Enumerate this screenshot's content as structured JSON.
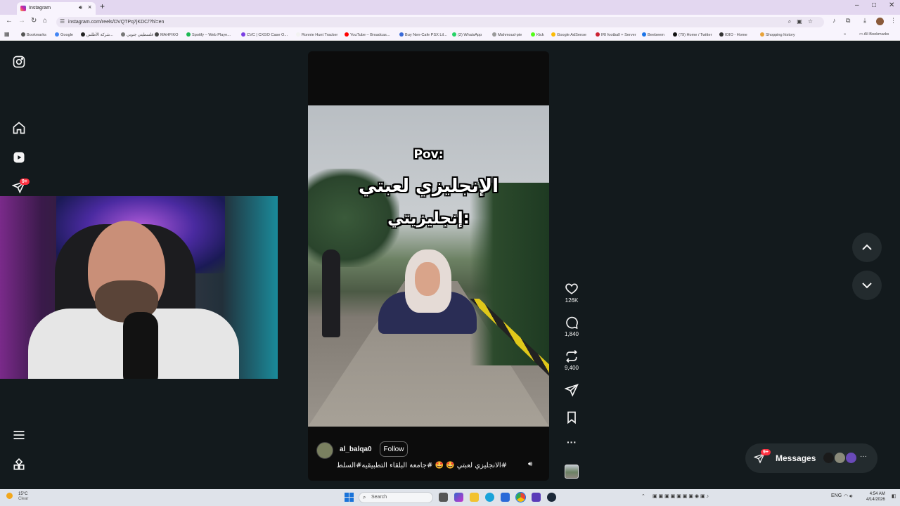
{
  "browser": {
    "tab_title": "Instagram",
    "url": "instagram.com/reels/DVQTPq7jKDC/?hl=en",
    "tab_sound_icon": "speaker-icon",
    "new_tab_label": "+",
    "bookmarks": [
      {
        "label": "Bookmarks",
        "color": "#555555"
      },
      {
        "label": "Google",
        "color": "#4285f4"
      },
      {
        "label": "شركة الأطلس...",
        "color": "#222222"
      },
      {
        "label": "فلسطيني جنوبي",
        "color": "#777777"
      },
      {
        "label": "MAHFIKO",
        "color": "#444444"
      },
      {
        "label": "Spotify – Web Playe...",
        "color": "#1db954"
      },
      {
        "label": "CVC | CXGO Case O...",
        "color": "#7b3fe4"
      },
      {
        "label": "Ronnie Hunt Tracker",
        "color": "#f2f2f2"
      },
      {
        "label": "YouTube – Broadcas...",
        "color": "#ff0000"
      },
      {
        "label": "Buy Nen-Cafe PSX Lil...",
        "color": "#3a6ad8"
      },
      {
        "label": "(2) WhatsApp",
        "color": "#25d366"
      },
      {
        "label": "Mahmoud-pie",
        "color": "#999999"
      },
      {
        "label": "Kick",
        "color": "#53fc18"
      },
      {
        "label": "Google AdSense",
        "color": "#fbbc05"
      },
      {
        "label": "IRI football + Server",
        "color": "#cc2233"
      },
      {
        "label": "Beebeem",
        "color": "#1a73e8"
      },
      {
        "label": "(79) Home / Twitter",
        "color": "#111111"
      },
      {
        "label": "IOIO - Home",
        "color": "#333333"
      },
      {
        "label": "Shopping history",
        "color": "#e8a33a"
      }
    ],
    "all_bookmarks": "All Bookmarks"
  },
  "sidebar": {
    "notifications_badge": "9+",
    "icons": [
      "instagram-logo-icon",
      "home-icon",
      "reels-icon",
      "messages-icon",
      "menu-icon",
      "apps-icon"
    ]
  },
  "reel": {
    "overlay_pov": "Pov:",
    "overlay_line1": "الإنجليزي لعبتي",
    "overlay_line2": "إنجليزيتي:",
    "username": "al_balqa0",
    "follow_label": "Follow",
    "caption": "#الانجليزي لعبتي 🤩 🤩 #جامعة البلقاء التطبيقيه#السلط",
    "likes": "126K",
    "comments": "1,840",
    "reposts": "9,400"
  },
  "messages": {
    "label": "Messages",
    "badge": "9+"
  },
  "taskbar": {
    "weather_temp": "15°C",
    "weather_desc": "Clear",
    "search_placeholder": "Search",
    "lang": "ENG",
    "time": "4:54 AM",
    "date": "4/14/2026"
  },
  "colors": {
    "page_bg": "#131a1d",
    "badge_red": "#ff3040",
    "chrome_tabstrip": "#e3d7f0"
  }
}
